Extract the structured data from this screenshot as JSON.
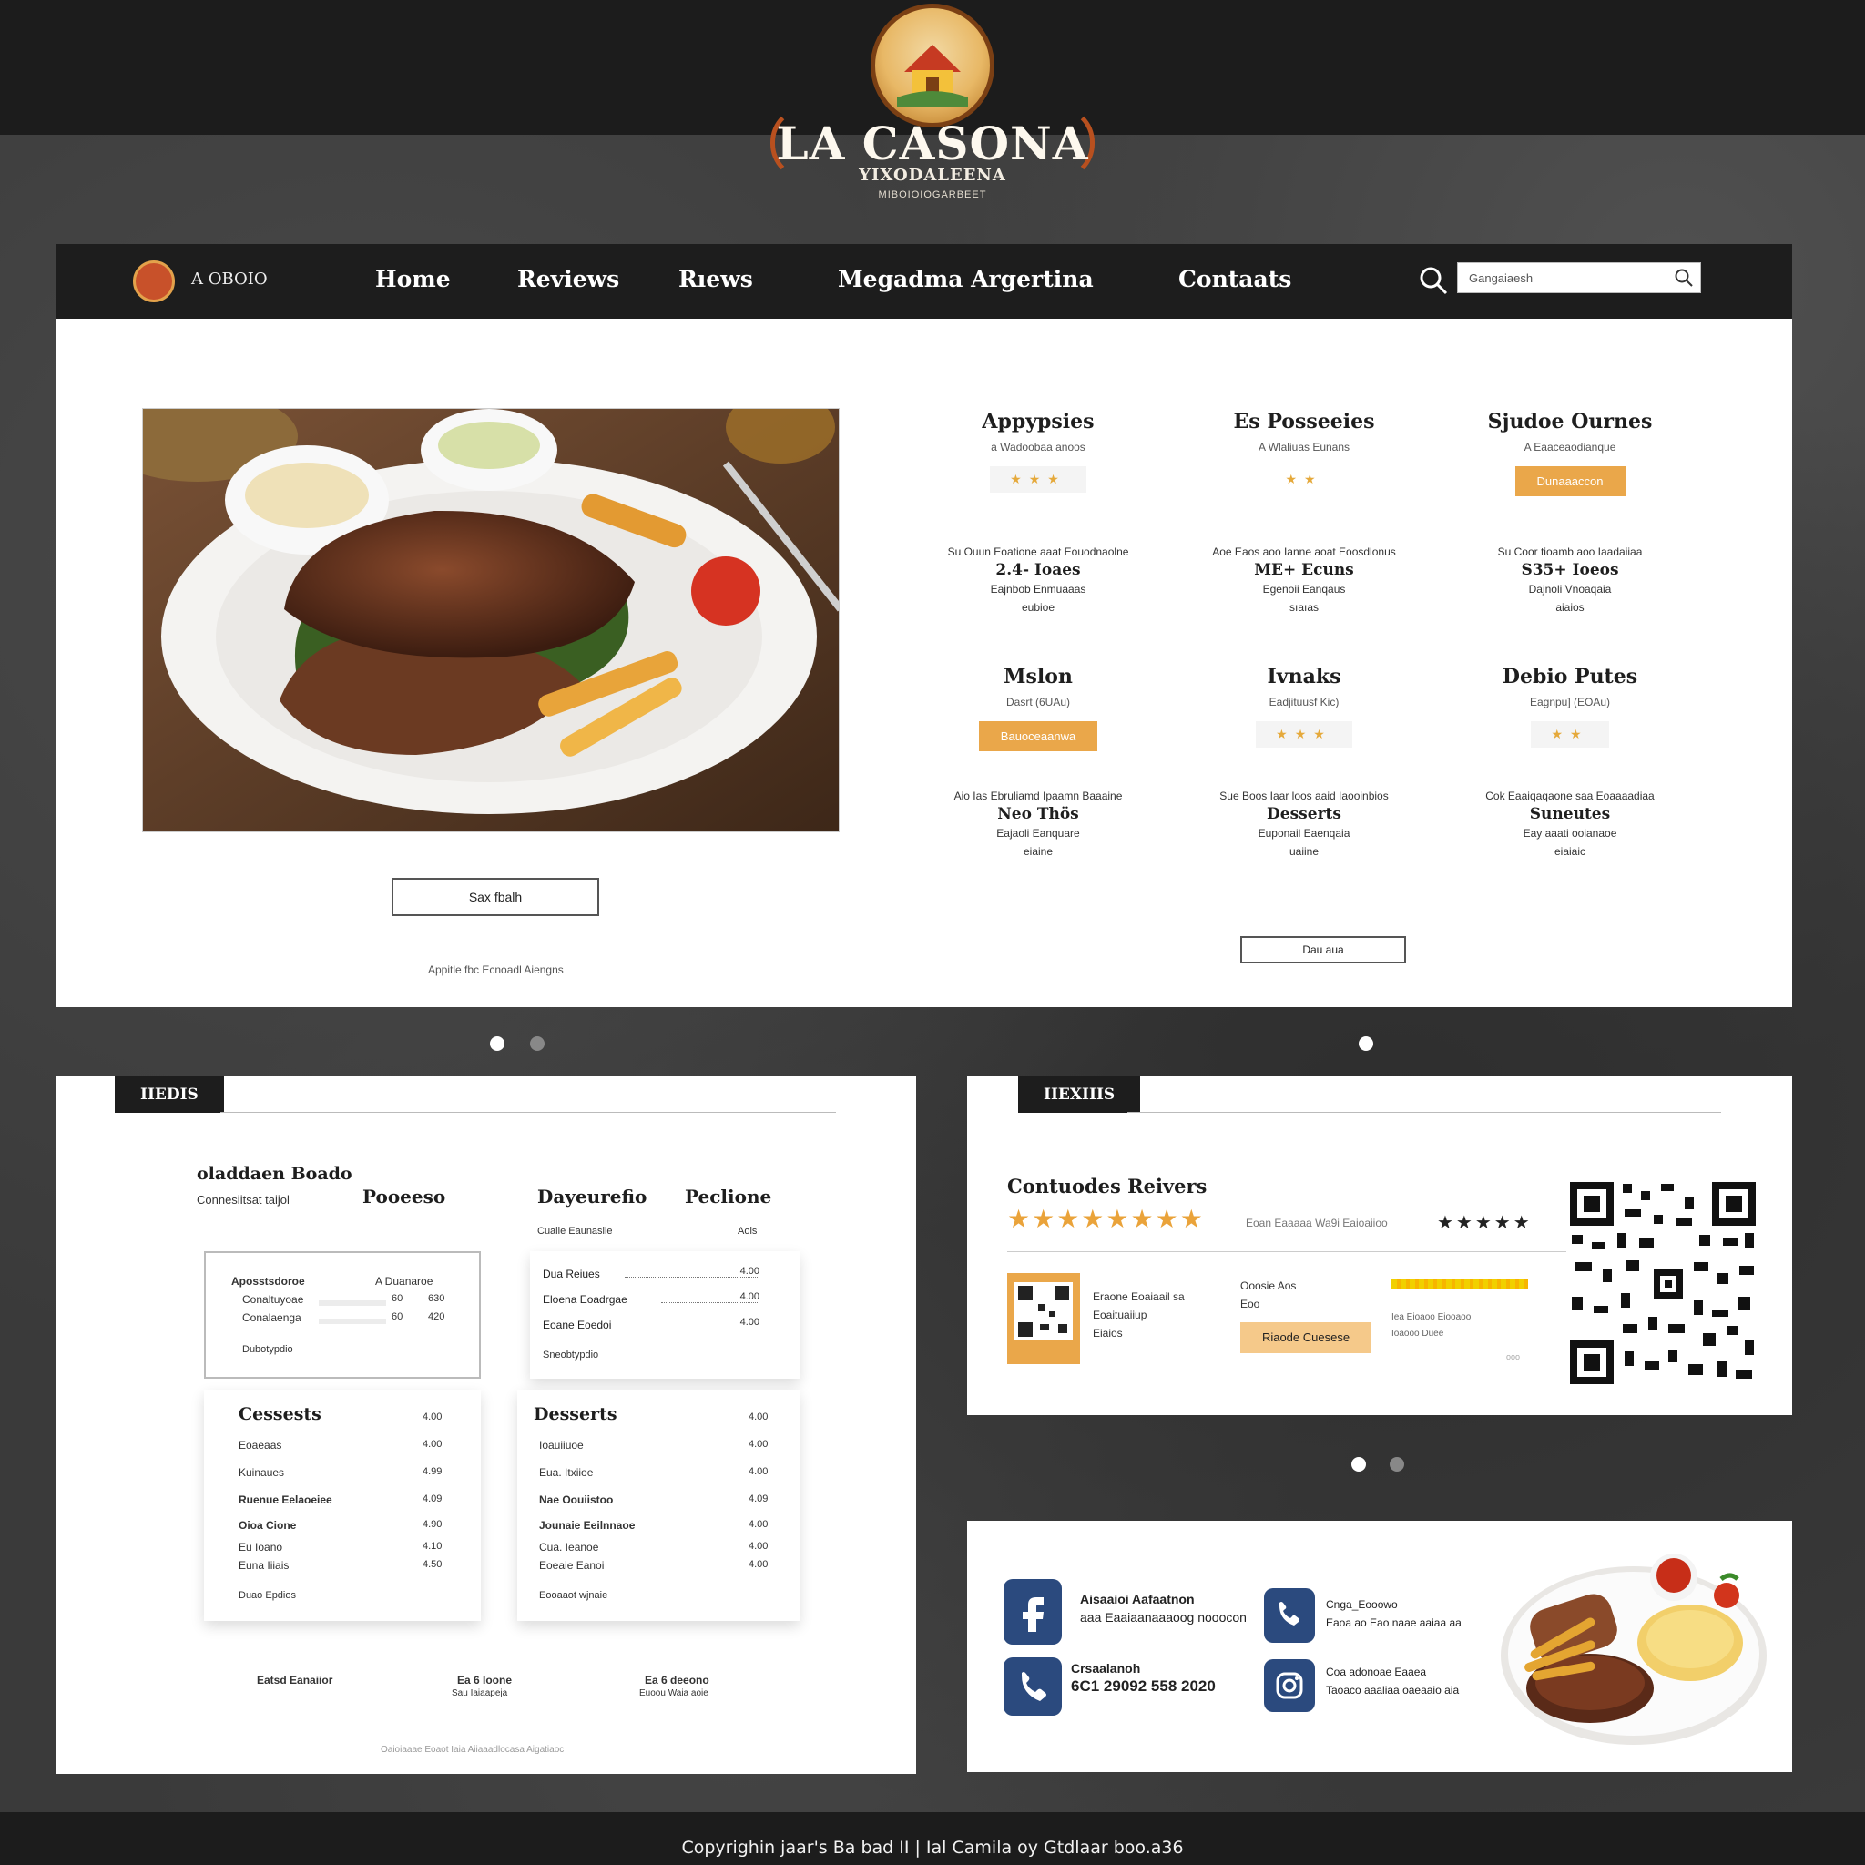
{
  "logo": {
    "title": "LA CASONA",
    "subtitle": "YIXODALEENA",
    "tagline": "MIBOIOIOGARBEET"
  },
  "nav": {
    "brand_text": "A OBOIO",
    "items": [
      "Home",
      "Reviews",
      "Rıews",
      "Megadma Argertina",
      "Contaats"
    ],
    "search_value": "Gangaiaesh"
  },
  "hero": {
    "button_label": "Sax fbalh",
    "caption": "Appitle fbc Ecnoadl Aiengns",
    "bottom_button_label": "Dau aua"
  },
  "categories": [
    {
      "title": "Appypsies",
      "sub": "a Wadoobaa anoos",
      "stars": "★★★",
      "control": "stars"
    },
    {
      "title": "Es Posseeies",
      "sub": "A Wlaliuas Eunans",
      "stars": "★★",
      "control": "stars"
    },
    {
      "title": "Sjudoe Ournes",
      "sub": "A Eaaceaodianque",
      "button": "Dunaaaccon",
      "control": "button"
    },
    {
      "title": "Mslon",
      "sub": "Dasrt (6UAu)",
      "button": "Bauoceaanwa",
      "control": "button"
    },
    {
      "title": "Ivnaks",
      "sub": "Eadjituusf Kic)",
      "stars": "★★★",
      "control": "stars"
    },
    {
      "title": "Debio Putes",
      "sub": "Eagnpu] (EOAu)",
      "stars": "★★",
      "control": "stars"
    }
  ],
  "items": [
    {
      "desc": "Su Ouun Eoatione aaat Eouodnaolne",
      "name": "2.4- Ioaes",
      "line2": "Eajnbob Enmuaaas",
      "line3": "eubioe"
    },
    {
      "desc": "Aoe Eaos aoo Ianne aoat Eoosdlonus",
      "name": "ME+ Ecuns",
      "line2": "Egenoii Eanqaus",
      "line3": "sıaıas"
    },
    {
      "desc": "Su Coor tioamb aoo Iaadaiiaa",
      "name": "S35+ Ioeos",
      "line2": "Dajnoli Vnoaqaia",
      "line3": "aiaios"
    },
    {
      "desc": "Aio Ias Ebruliamd Ipaamn Baaaine",
      "name": "Neo Thös",
      "line2": "Eajaoli Eanquare",
      "line3": "eiaine"
    },
    {
      "desc": "Sue Boos Iaar loos aaid Iaooinbios",
      "name": "Desserts",
      "line2": "Euponail Eaenqaia",
      "line3": "uaiine"
    },
    {
      "desc": "Cok Eaaiqaqaone saa Eoaaaadiaa",
      "name": "Suneutes",
      "line2": "Eay aaati ooianaoe",
      "line3": "eiaiaic"
    }
  ],
  "menu": {
    "tab": "IIEDIS",
    "left_title": "oladdaen Boado",
    "left_sub": "Connesiitsat taijol",
    "col1": "Pooeeso",
    "col2": "Dayeurefio",
    "col3": "Peclione",
    "col2_sub": "Cuaiie Eaunasiie",
    "col3_sub": "Aois",
    "card1": {
      "head_left": "Aposstsdoroe",
      "head_right": "A Duanaroe",
      "rows": [
        {
          "n": "Conaltuyoae",
          "a": "60",
          "p": "630"
        },
        {
          "n": "Conalaenga",
          "a": "60",
          "p": "420"
        }
      ],
      "foot": "Dubotypdio"
    },
    "card2": {
      "rows": [
        {
          "n": "Dua Reiues",
          "p": "4.00"
        },
        {
          "n": "Eloena Eoadrgae",
          "p": "4.00"
        },
        {
          "n": "Eoane Eoedoi",
          "p": "4.00"
        }
      ],
      "foot": "Sneobtypdio"
    },
    "card3": {
      "title": "Cessests",
      "title_price": "4.00",
      "rows": [
        {
          "n": "Eoaeaas",
          "p": "4.00"
        },
        {
          "n": "Kuinaues",
          "p": "4.99"
        },
        {
          "n": "Ruenue Eelaoeiee",
          "p": "4.09"
        },
        {
          "n": "Oioa Cione",
          "p": "4.90"
        },
        {
          "n": "Eu Ioano",
          "p": "4.10"
        },
        {
          "n": "Euna Iiiais",
          "p": "4.50"
        }
      ],
      "foot": "Duao Epdios"
    },
    "card4": {
      "title": "Desserts",
      "title_price": "4.00",
      "rows": [
        {
          "n": "Ioauiiuoe",
          "p": "4.00"
        },
        {
          "n": "Eua. Itxiioe",
          "p": "4.00"
        },
        {
          "n": "Nae Oouiistoo",
          "p": "4.09"
        },
        {
          "n": "Jounaie Eeilnnaoe",
          "p": "4.00"
        },
        {
          "n": "Cua. Ieanoe",
          "p": "4.00"
        },
        {
          "n": "Eoeaie Eanoi",
          "p": "4.00"
        }
      ],
      "foot": "Eooaaot wjnaie"
    },
    "footer": [
      {
        "title": "Eatsd Eanaiior",
        "sub": ""
      },
      {
        "title": "Ea 6 Ioone",
        "sub": "Sau Iaiaapeja"
      },
      {
        "title": "Ea 6 deeono",
        "sub": "Euoou Waia aoie"
      }
    ],
    "bottom_note": "Oaioiaaae Eoaot    Iaia Aiiaaadlocasa Aigatiaoc"
  },
  "reviews": {
    "tab": "IIEXIIIS",
    "title": "Contuodes Reivers",
    "stars": "★★★★★★★★",
    "mid_text": "Eoan Eaaaaa Wa9i Eaioaiioo",
    "dark_stars": "★★★★★",
    "text1": [
      "Eraone Eoaiaail sa",
      "Eoaituaiiup",
      "Eiaios"
    ],
    "text2": [
      "Ooosie Aos",
      "Eoo"
    ],
    "button": "Riaode Cuesese",
    "text3": [
      "Iea Eioaoo Eiooaoo",
      "Ioaooo Duee"
    ],
    "note": "ooo"
  },
  "contact": {
    "items": [
      {
        "title": "Aisaaioi Aafaatnon",
        "sub": "aaa Eaaiaanaaaoog nooocon",
        "icon": "facebook-icon"
      },
      {
        "title": "Cnga_Eooowo",
        "sub": "Eaoa ao Eao naae aaiaa aa",
        "icon": "whatsapp-icon"
      },
      {
        "title": "Crsaalanoh",
        "sub": "6C1 29092 558 2020",
        "icon": "phone-icon"
      },
      {
        "title": "Coa adonoae Eaaea",
        "sub": "Taoaco aaaliaa oaeaaio aia",
        "icon": "instagram-icon"
      }
    ]
  },
  "footer": {
    "text": "Copyrighin jaar's Ba bad II | Ial Camila oy Gtdlaar boo.a36"
  },
  "colors": {
    "accent": "#eaa74a",
    "dark": "#1d1d1d",
    "social": "#2b4a7e"
  }
}
